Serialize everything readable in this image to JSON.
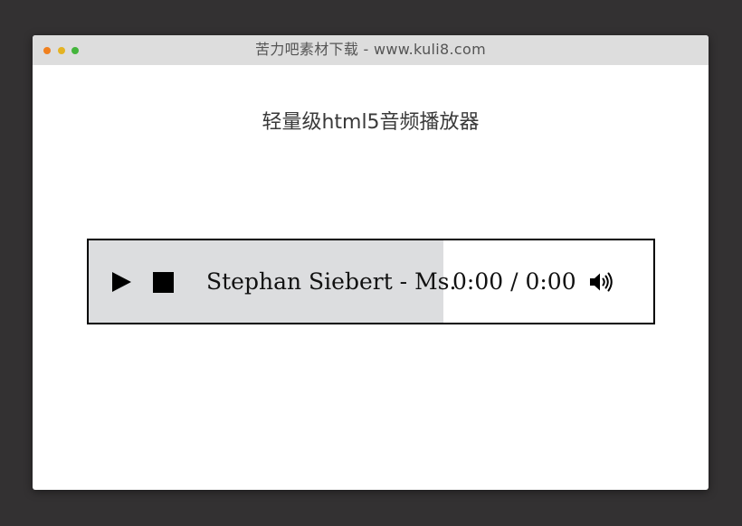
{
  "window": {
    "title": "苦力吧素材下载 - www.kuli8.com",
    "traffic_lights": {
      "close_color": "#f0801f",
      "minimize_color": "#e4b323",
      "maximize_color": "#44b53c"
    }
  },
  "page": {
    "heading": "轻量级html5音频播放器"
  },
  "player": {
    "play_icon": "play-icon",
    "stop_icon": "stop-icon",
    "volume_icon": "volume-icon",
    "track_title": "Stephan Siebert - Ms.",
    "current_time": "0:00",
    "time_separator": "/",
    "duration": "0:00",
    "time_display": "0:00 / 0:00",
    "progress_fraction": 0,
    "colors": {
      "panel_background": "#dcdddf",
      "border": "#000000"
    }
  }
}
